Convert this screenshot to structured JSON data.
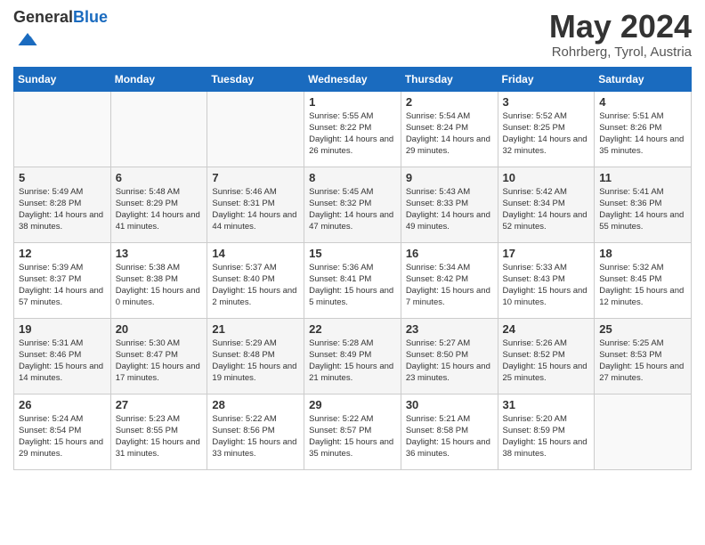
{
  "header": {
    "logo_general": "General",
    "logo_blue": "Blue",
    "month_title": "May 2024",
    "location": "Rohrberg, Tyrol, Austria"
  },
  "days_of_week": [
    "Sunday",
    "Monday",
    "Tuesday",
    "Wednesday",
    "Thursday",
    "Friday",
    "Saturday"
  ],
  "weeks": [
    [
      {
        "day": "",
        "info": ""
      },
      {
        "day": "",
        "info": ""
      },
      {
        "day": "",
        "info": ""
      },
      {
        "day": "1",
        "info": "Sunrise: 5:55 AM\nSunset: 8:22 PM\nDaylight: 14 hours\nand 26 minutes."
      },
      {
        "day": "2",
        "info": "Sunrise: 5:54 AM\nSunset: 8:24 PM\nDaylight: 14 hours\nand 29 minutes."
      },
      {
        "day": "3",
        "info": "Sunrise: 5:52 AM\nSunset: 8:25 PM\nDaylight: 14 hours\nand 32 minutes."
      },
      {
        "day": "4",
        "info": "Sunrise: 5:51 AM\nSunset: 8:26 PM\nDaylight: 14 hours\nand 35 minutes."
      }
    ],
    [
      {
        "day": "5",
        "info": "Sunrise: 5:49 AM\nSunset: 8:28 PM\nDaylight: 14 hours\nand 38 minutes."
      },
      {
        "day": "6",
        "info": "Sunrise: 5:48 AM\nSunset: 8:29 PM\nDaylight: 14 hours\nand 41 minutes."
      },
      {
        "day": "7",
        "info": "Sunrise: 5:46 AM\nSunset: 8:31 PM\nDaylight: 14 hours\nand 44 minutes."
      },
      {
        "day": "8",
        "info": "Sunrise: 5:45 AM\nSunset: 8:32 PM\nDaylight: 14 hours\nand 47 minutes."
      },
      {
        "day": "9",
        "info": "Sunrise: 5:43 AM\nSunset: 8:33 PM\nDaylight: 14 hours\nand 49 minutes."
      },
      {
        "day": "10",
        "info": "Sunrise: 5:42 AM\nSunset: 8:34 PM\nDaylight: 14 hours\nand 52 minutes."
      },
      {
        "day": "11",
        "info": "Sunrise: 5:41 AM\nSunset: 8:36 PM\nDaylight: 14 hours\nand 55 minutes."
      }
    ],
    [
      {
        "day": "12",
        "info": "Sunrise: 5:39 AM\nSunset: 8:37 PM\nDaylight: 14 hours\nand 57 minutes."
      },
      {
        "day": "13",
        "info": "Sunrise: 5:38 AM\nSunset: 8:38 PM\nDaylight: 15 hours\nand 0 minutes."
      },
      {
        "day": "14",
        "info": "Sunrise: 5:37 AM\nSunset: 8:40 PM\nDaylight: 15 hours\nand 2 minutes."
      },
      {
        "day": "15",
        "info": "Sunrise: 5:36 AM\nSunset: 8:41 PM\nDaylight: 15 hours\nand 5 minutes."
      },
      {
        "day": "16",
        "info": "Sunrise: 5:34 AM\nSunset: 8:42 PM\nDaylight: 15 hours\nand 7 minutes."
      },
      {
        "day": "17",
        "info": "Sunrise: 5:33 AM\nSunset: 8:43 PM\nDaylight: 15 hours\nand 10 minutes."
      },
      {
        "day": "18",
        "info": "Sunrise: 5:32 AM\nSunset: 8:45 PM\nDaylight: 15 hours\nand 12 minutes."
      }
    ],
    [
      {
        "day": "19",
        "info": "Sunrise: 5:31 AM\nSunset: 8:46 PM\nDaylight: 15 hours\nand 14 minutes."
      },
      {
        "day": "20",
        "info": "Sunrise: 5:30 AM\nSunset: 8:47 PM\nDaylight: 15 hours\nand 17 minutes."
      },
      {
        "day": "21",
        "info": "Sunrise: 5:29 AM\nSunset: 8:48 PM\nDaylight: 15 hours\nand 19 minutes."
      },
      {
        "day": "22",
        "info": "Sunrise: 5:28 AM\nSunset: 8:49 PM\nDaylight: 15 hours\nand 21 minutes."
      },
      {
        "day": "23",
        "info": "Sunrise: 5:27 AM\nSunset: 8:50 PM\nDaylight: 15 hours\nand 23 minutes."
      },
      {
        "day": "24",
        "info": "Sunrise: 5:26 AM\nSunset: 8:52 PM\nDaylight: 15 hours\nand 25 minutes."
      },
      {
        "day": "25",
        "info": "Sunrise: 5:25 AM\nSunset: 8:53 PM\nDaylight: 15 hours\nand 27 minutes."
      }
    ],
    [
      {
        "day": "26",
        "info": "Sunrise: 5:24 AM\nSunset: 8:54 PM\nDaylight: 15 hours\nand 29 minutes."
      },
      {
        "day": "27",
        "info": "Sunrise: 5:23 AM\nSunset: 8:55 PM\nDaylight: 15 hours\nand 31 minutes."
      },
      {
        "day": "28",
        "info": "Sunrise: 5:22 AM\nSunset: 8:56 PM\nDaylight: 15 hours\nand 33 minutes."
      },
      {
        "day": "29",
        "info": "Sunrise: 5:22 AM\nSunset: 8:57 PM\nDaylight: 15 hours\nand 35 minutes."
      },
      {
        "day": "30",
        "info": "Sunrise: 5:21 AM\nSunset: 8:58 PM\nDaylight: 15 hours\nand 36 minutes."
      },
      {
        "day": "31",
        "info": "Sunrise: 5:20 AM\nSunset: 8:59 PM\nDaylight: 15 hours\nand 38 minutes."
      },
      {
        "day": "",
        "info": ""
      }
    ]
  ]
}
